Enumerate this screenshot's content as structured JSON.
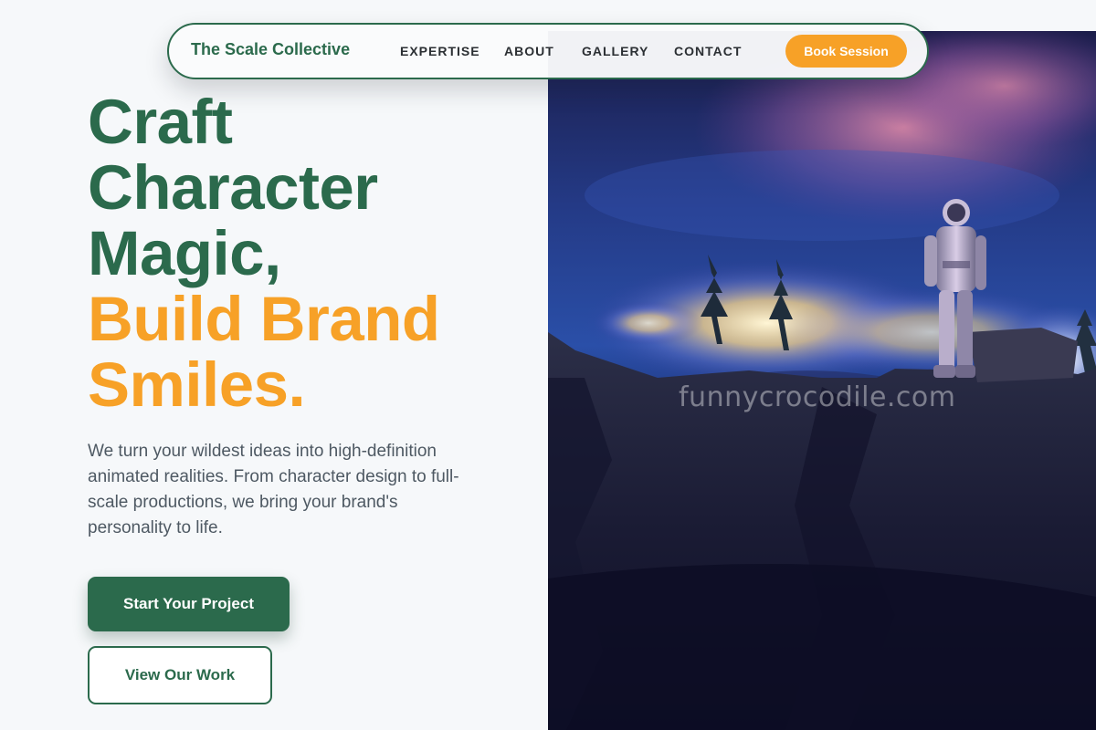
{
  "nav": {
    "brand": "The Scale Collective",
    "links": [
      "EXPERTISE",
      "ABOUT",
      "GALLERY",
      "CONTACT"
    ],
    "cta": "Book Session"
  },
  "hero": {
    "headline_lines": [
      "Craft",
      "Character",
      "Magic,"
    ],
    "headline_accent_lines": [
      "Build Brand",
      "Smiles."
    ],
    "lead": "We turn your wildest ideas into high-definition animated realities. From character design to full-scale productions, we bring your brand's personality to life.",
    "primary_cta": "Start Your Project",
    "secondary_cta": "View Our Work",
    "image_watermark": "funnycrocodile.com"
  },
  "colors": {
    "brand_green": "#2b6a4c",
    "accent_orange": "#f7a127",
    "page_background": "#f6f8fa",
    "body_text": "#4e5963"
  }
}
